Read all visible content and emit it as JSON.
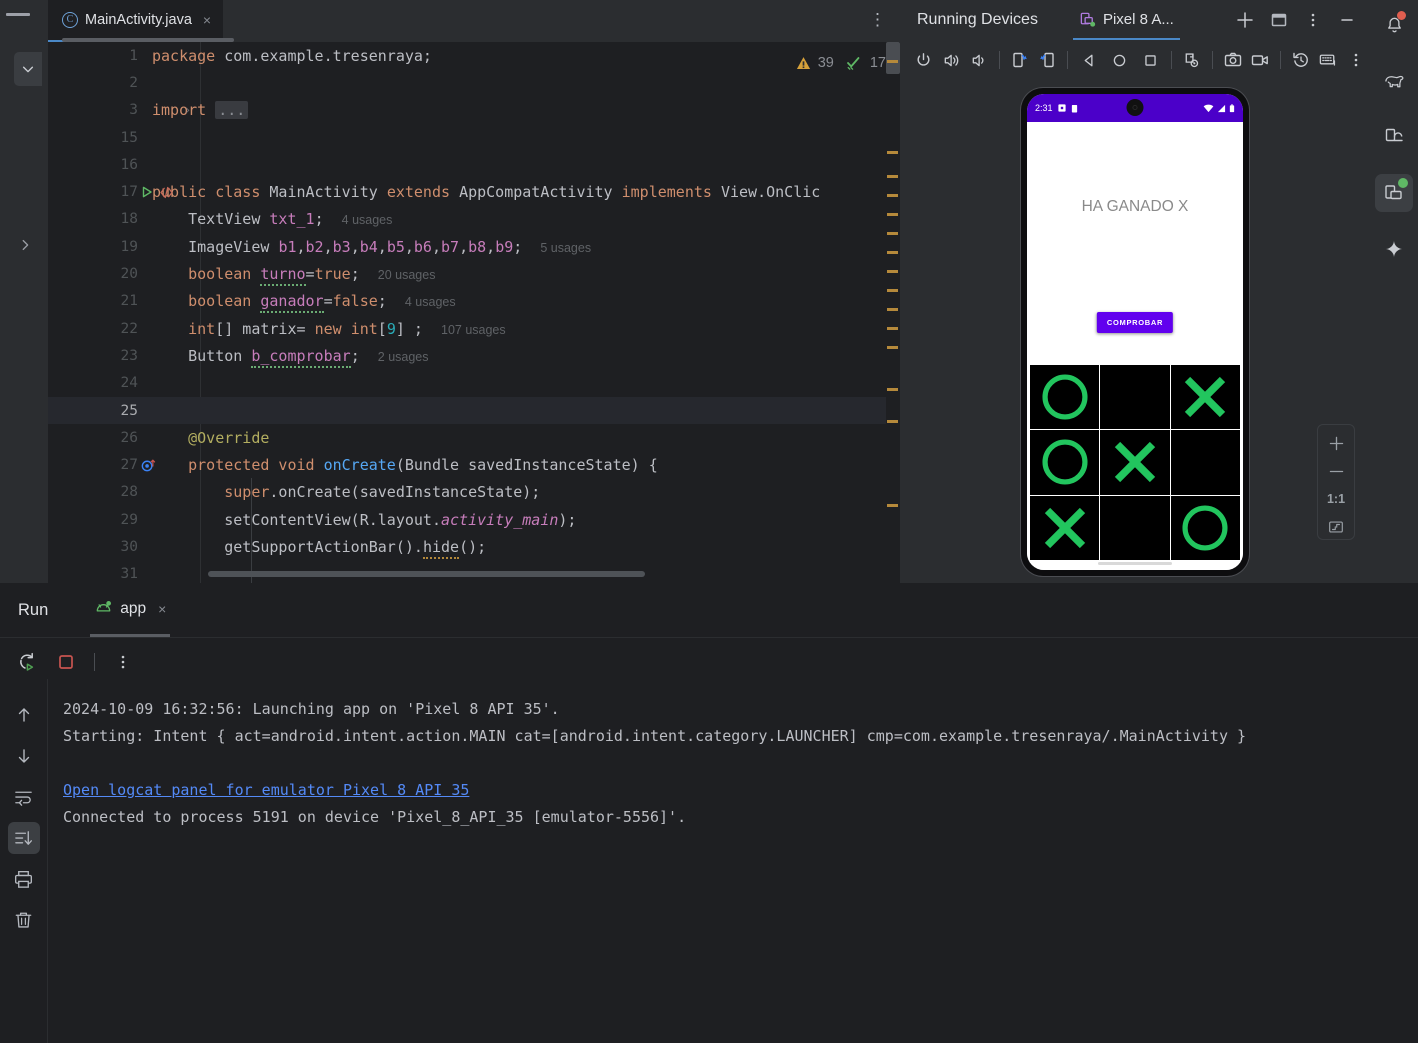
{
  "editor": {
    "tab": {
      "label": "MainActivity.java",
      "file_icon": "java-class-icon",
      "close": "×",
      "menu": "⋮"
    },
    "inspections": {
      "warning_icon": "warning-triangle-icon",
      "warning_count": "39",
      "check_icon": "double-check-icon",
      "check_count": "17"
    },
    "lines": [
      {
        "n": "1",
        "html": "<span class=\"kw\">package</span> <span class=\"pln\">com.example.tresenraya;</span>"
      },
      {
        "n": "2",
        "html": ""
      },
      {
        "n": "3",
        "html": "<span class=\"kw\">import</span> <span class=\"foldbox\">...</span>"
      },
      {
        "n": "15",
        "html": ""
      },
      {
        "n": "16",
        "html": ""
      },
      {
        "n": "17",
        "html": "<span class=\"kw\">public class</span> <span class=\"pln\">MainActivity</span> <span class=\"kw\">extends</span> <span class=\"pln\">AppCompatActivity</span> <span class=\"kw\">implements</span> <span class=\"pln\">View.OnClic</span>"
      },
      {
        "n": "18",
        "html": "    <span class=\"pln\">TextView</span> <span class=\"fld\">txt_1</span><span class=\"pln\">;</span>  <span class=\"usg\">4 usages</span>"
      },
      {
        "n": "19",
        "html": "    <span class=\"pln\">ImageView</span> <span class=\"fld\">b1</span><span class=\"pln\">,</span><span class=\"fld\">b2</span><span class=\"pln\">,</span><span class=\"fld\">b3</span><span class=\"pln\">,</span><span class=\"fld\">b4</span><span class=\"pln\">,</span><span class=\"fld\">b5</span><span class=\"pln\">,</span><span class=\"fld\">b6</span><span class=\"pln\">,</span><span class=\"fld\">b7</span><span class=\"pln\">,</span><span class=\"fld\">b8</span><span class=\"pln\">,</span><span class=\"fld\">b9</span><span class=\"pln\">;</span>  <span class=\"usg\">5 usages</span>"
      },
      {
        "n": "20",
        "html": "    <span class=\"kw\">boolean</span> <span class=\"fld wavy\">turno</span><span class=\"pln\">=</span><span class=\"kw\">true</span><span class=\"pln\">;</span>  <span class=\"usg\">20 usages</span>"
      },
      {
        "n": "21",
        "html": "    <span class=\"kw\">boolean</span> <span class=\"fld wavy\">ganador</span><span class=\"pln\">=</span><span class=\"kw\">false</span><span class=\"pln\">;</span>  <span class=\"usg\">4 usages</span>"
      },
      {
        "n": "22",
        "html": "    <span class=\"kw\">int</span><span class=\"pln\">[] matrix= </span><span class=\"kw\">new</span> <span class=\"kw\">int</span><span class=\"pln\">[</span><span class=\"num\">9</span><span class=\"pln\">] ;</span>  <span class=\"usg\">107 usages</span>"
      },
      {
        "n": "23",
        "html": "    <span class=\"pln\">Button</span> <span class=\"fld wavy\">b_comprobar</span><span class=\"pln\">;</span>  <span class=\"usg\">2 usages</span>"
      },
      {
        "n": "24",
        "html": ""
      },
      {
        "n": "25",
        "html": "",
        "current": true
      },
      {
        "n": "26",
        "html": "    <span class=\"ann\">@Override</span>"
      },
      {
        "n": "27",
        "html": "    <span class=\"kw\">protected void</span> <span class=\"mth\">onCreate</span><span class=\"pln\">(Bundle savedInstanceState) {</span>",
        "gutter": "override-method-icon"
      },
      {
        "n": "28",
        "html": "        <span class=\"kw\">super</span><span class=\"pln\">.onCreate(savedInstanceState);</span>"
      },
      {
        "n": "29",
        "html": "        <span class=\"pln\">setContentView(R.layout.</span><span class=\"fld italic\">activity_main</span><span class=\"pln\">);</span>"
      },
      {
        "n": "30",
        "html": "        <span class=\"pln\">getSupportActionBar().</span><span class=\"pln wavy-y\">hide</span><span class=\"pln\">();</span>"
      },
      {
        "n": "31",
        "html": ""
      }
    ]
  },
  "devices": {
    "panel_title": "Running Devices",
    "tab_label": "Pixel 8 A...",
    "tab_icon": "device-running-icon",
    "header_buttons": [
      {
        "name": "add-device-button",
        "icon": "plus-icon"
      },
      {
        "name": "split-window-button",
        "icon": "window-icon"
      },
      {
        "name": "panel-options-button",
        "icon": "more-vertical-icon"
      },
      {
        "name": "minimize-panel-button",
        "icon": "minimize-icon"
      }
    ],
    "toolbar": [
      {
        "name": "power-button",
        "icon": "power-icon"
      },
      {
        "name": "volume-up-button",
        "icon": "volume-up-icon"
      },
      {
        "name": "volume-down-button",
        "icon": "volume-down-icon"
      },
      {
        "name": "rotate-left-button",
        "icon": "rotate-left-icon"
      },
      {
        "name": "rotate-right-button",
        "icon": "rotate-right-icon"
      },
      {
        "name": "back-button",
        "icon": "back-triangle-icon"
      },
      {
        "name": "home-button",
        "icon": "home-circle-icon"
      },
      {
        "name": "overview-button",
        "icon": "overview-square-icon"
      },
      {
        "name": "device-settings-button",
        "icon": "device-gear-icon"
      },
      {
        "name": "screenshot-button",
        "icon": "camera-icon"
      },
      {
        "name": "record-screen-button",
        "icon": "video-camera-icon"
      },
      {
        "name": "device-history-button",
        "icon": "history-icon"
      },
      {
        "name": "hardware-input-button",
        "icon": "keyboard-icon"
      },
      {
        "name": "more-actions-button",
        "icon": "more-vertical-icon"
      }
    ],
    "zoom_controls": {
      "zoom_in": "+",
      "zoom_out": "−",
      "actual_size": "1:1",
      "fit_to_window_icon": "fit-screen-icon"
    }
  },
  "phone": {
    "status_bar": {
      "time": "2:31",
      "left_icons": [
        "app-notification-icon",
        "battery-saver-icon"
      ],
      "right_icons": [
        "wifi-icon",
        "signal-icon",
        "battery-icon"
      ],
      "background": "#4b00c9"
    },
    "win_message": "HA GANADO X",
    "check_button": "COMPROBAR",
    "button_color": "#6100ee",
    "mark_color": "#22c55e",
    "board": [
      [
        "O",
        "",
        "X"
      ],
      [
        "O",
        "X",
        ""
      ],
      [
        "X",
        "",
        "O"
      ]
    ]
  },
  "right_sidebar": [
    {
      "name": "notifications-icon",
      "badge": "#e05e4f"
    },
    {
      "name": "gradle-elephant-icon",
      "badge": ""
    },
    {
      "name": "device-manager-icon",
      "badge": ""
    },
    {
      "name": "running-devices-icon",
      "badge": "#5fb865",
      "active": true
    },
    {
      "name": "gemini-sparkle-icon",
      "badge": ""
    }
  ],
  "run_panel": {
    "title": "Run",
    "tab_label": "app",
    "tab_icon": "android-running-icon",
    "tab_close": "×",
    "toolbar": [
      {
        "name": "rerun-button",
        "icon": "rerun-icon"
      },
      {
        "name": "stop-button",
        "icon": "stop-square-icon"
      },
      {
        "name": "run-more-button",
        "icon": "more-vertical-icon"
      }
    ],
    "console_side_buttons": [
      {
        "name": "scroll-up-button",
        "icon": "arrow-up-icon"
      },
      {
        "name": "scroll-down-button",
        "icon": "arrow-down-icon"
      },
      {
        "name": "soft-wrap-button",
        "icon": "soft-wrap-icon"
      },
      {
        "name": "scroll-to-end-button",
        "icon": "scroll-end-icon",
        "active": true
      },
      {
        "name": "print-button",
        "icon": "printer-icon"
      },
      {
        "name": "clear-console-button",
        "icon": "trash-icon"
      }
    ],
    "console_lines": [
      {
        "text": "2024-10-09 16:32:56: Launching app on 'Pixel 8 API 35'.",
        "link": false
      },
      {
        "text": "Starting: Intent { act=android.intent.action.MAIN cat=[android.intent.category.LAUNCHER] cmp=com.example.tresenraya/.MainActivity }",
        "link": false
      },
      {
        "text": "",
        "link": false
      },
      {
        "text": "Open logcat panel for emulator Pixel 8 API 35",
        "link": true
      },
      {
        "text": "Connected to process 5191 on device 'Pixel_8_API_35 [emulator-5556]'.",
        "link": false
      }
    ]
  }
}
